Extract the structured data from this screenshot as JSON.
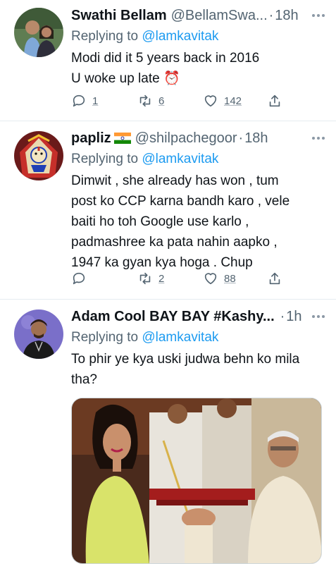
{
  "tweets": [
    {
      "name": "Swathi Bellam",
      "handle": "@BellamSwa...",
      "dot": "·",
      "time": "18h",
      "reply_prefix": "Replying to ",
      "reply_to": "@lamkavitak",
      "lines": [
        "Modi did it 5 years back in 2016",
        "U woke up late ⏰"
      ],
      "reply_count": "1",
      "retweet_count": "6",
      "like_count": "142",
      "avatar_icon": "couple-photo"
    },
    {
      "name": "papliz",
      "flag_icon": "india-flag-icon",
      "handle": "@shilpachegoor",
      "dot": "·",
      "time": "18h",
      "reply_prefix": "Replying to ",
      "reply_to": "@lamkavitak",
      "lines": [
        "Dimwit , she already has won , tum",
        "post ko CCP karna bandh karo , vele",
        "baiti ho toh Google use karlo ,",
        "padmashree ka pata nahin aapko ,",
        "1947 ka gyan kya hoga . Chup"
      ],
      "reply_count": "",
      "retweet_count": "2",
      "like_count": "88",
      "avatar_icon": "goddess-art"
    },
    {
      "name": "Adam Cool BAY BAY #Kashy...",
      "handle": "",
      "dot": "·",
      "time": "1h",
      "reply_prefix": "Replying to ",
      "reply_to": "@lamkavitak",
      "lines": [
        "To phir ye kya uski judwa behn ko mila",
        "tha?"
      ],
      "avatar_icon": "man-portrait",
      "image_icon": "award-ceremony-photo"
    }
  ],
  "colors": {
    "link": "#1d9bf0",
    "secondary": "#536471",
    "primary": "#0f1419",
    "divider": "#e6ecf0"
  }
}
